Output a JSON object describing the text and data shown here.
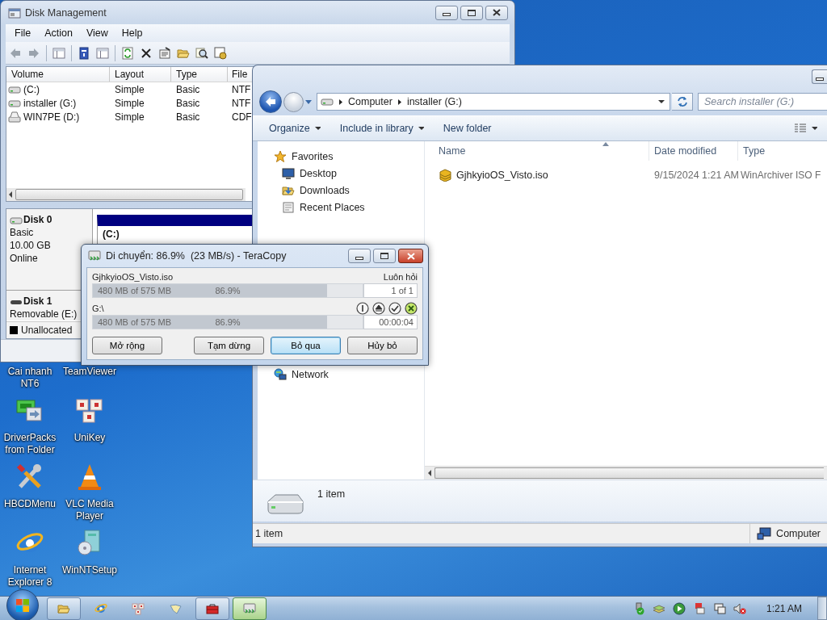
{
  "disk_management": {
    "title": "Disk Management",
    "menu": [
      "File",
      "Action",
      "View",
      "Help"
    ],
    "columns": [
      "Volume",
      "Layout",
      "Type",
      "File"
    ],
    "volumes": [
      {
        "kind": "disk",
        "cells": [
          "(C:)",
          "Simple",
          "Basic",
          "NTF"
        ]
      },
      {
        "kind": "disk",
        "cells": [
          "installer (G:)",
          "Simple",
          "Basic",
          "NTF"
        ]
      },
      {
        "kind": "cd",
        "cells": [
          "WIN7PE (D:)",
          "Simple",
          "Basic",
          "CDF"
        ]
      }
    ],
    "disks": [
      {
        "name": "Disk 0",
        "kind": "fixed",
        "details": [
          "Basic",
          "10.00 GB",
          "Online"
        ],
        "partition": "(C:)"
      },
      {
        "name": "Disk 1",
        "kind": "removable",
        "details": [
          "Removable (E:)"
        ]
      }
    ],
    "legend": [
      {
        "label": "Unallocated",
        "color": "#000000"
      }
    ]
  },
  "explorer": {
    "breadcrumb": [
      "Computer",
      "installer (G:)"
    ],
    "search": {
      "placeholder": "Search installer (G:)"
    },
    "commands": [
      {
        "label": "Organize",
        "dropdown": true
      },
      {
        "label": "Include in library",
        "dropdown": true
      },
      {
        "label": "New folder",
        "dropdown": false
      }
    ],
    "navigation": [
      {
        "label": "Favorites",
        "kind": "favorites",
        "children": [
          {
            "label": "Desktop",
            "kind": "desktop"
          },
          {
            "label": "Downloads",
            "kind": "downloads"
          },
          {
            "label": "Recent Places",
            "kind": "recent"
          }
        ]
      },
      {
        "label": "Network",
        "kind": "network"
      }
    ],
    "columns": [
      {
        "label": "Name",
        "sorted": true
      },
      {
        "label": "Date modified",
        "sorted": false
      },
      {
        "label": "Type",
        "sorted": false
      }
    ],
    "files": [
      {
        "name": "GjhkyioOS_Visto.iso",
        "date": "9/15/2024 1:21 AM",
        "type": "WinArchiver ISO F"
      }
    ],
    "details_pane": "1 item",
    "status_bar": {
      "left": "1 item",
      "right": "Computer"
    }
  },
  "teracopy": {
    "title": "Di chuyển: 86.9%  (23 MB/s) - TeraCopy",
    "file": "GjhkyioOS_Visto.iso",
    "mode": "Luôn hỏi",
    "destination": "G:\\",
    "progress": [
      {
        "amount": "480 MB of 575 MB",
        "percent": "86.9%",
        "level": 0.869,
        "info": "1 of 1"
      },
      {
        "amount": "480 MB of 575 MB",
        "percent": "86.9%",
        "level": 0.869,
        "info": "00:00:04"
      }
    ],
    "buttons": [
      {
        "label": "Mở rộng",
        "focused": false
      },
      {
        "label": "Tạm dừng",
        "focused": false
      },
      {
        "label": "Bỏ qua",
        "focused": true
      },
      {
        "label": "Hủy bỏ",
        "focused": false
      }
    ]
  },
  "desktop_icons": [
    {
      "label": "Cai nhanh NT6"
    },
    {
      "label": "TeamViewer"
    },
    {
      "label": "DriverPacks from Folder"
    },
    {
      "label": "UniKey"
    },
    {
      "label": "HBCDMenu"
    },
    {
      "label": "VLC Media Player"
    },
    {
      "label": "Internet Explorer 8"
    },
    {
      "label": "WinNTSetup"
    }
  ],
  "taskbar": {
    "buttons": [
      {
        "kind": "explorer",
        "running": true,
        "active": false
      },
      {
        "kind": "ie",
        "running": false,
        "active": false
      },
      {
        "kind": "unikey",
        "running": false,
        "active": false
      },
      {
        "kind": "bird",
        "running": false,
        "active": false
      },
      {
        "kind": "toolbox",
        "running": true,
        "active": false
      },
      {
        "kind": "teracopy",
        "running": true,
        "active": true
      }
    ],
    "clock": "1:21 AM"
  }
}
